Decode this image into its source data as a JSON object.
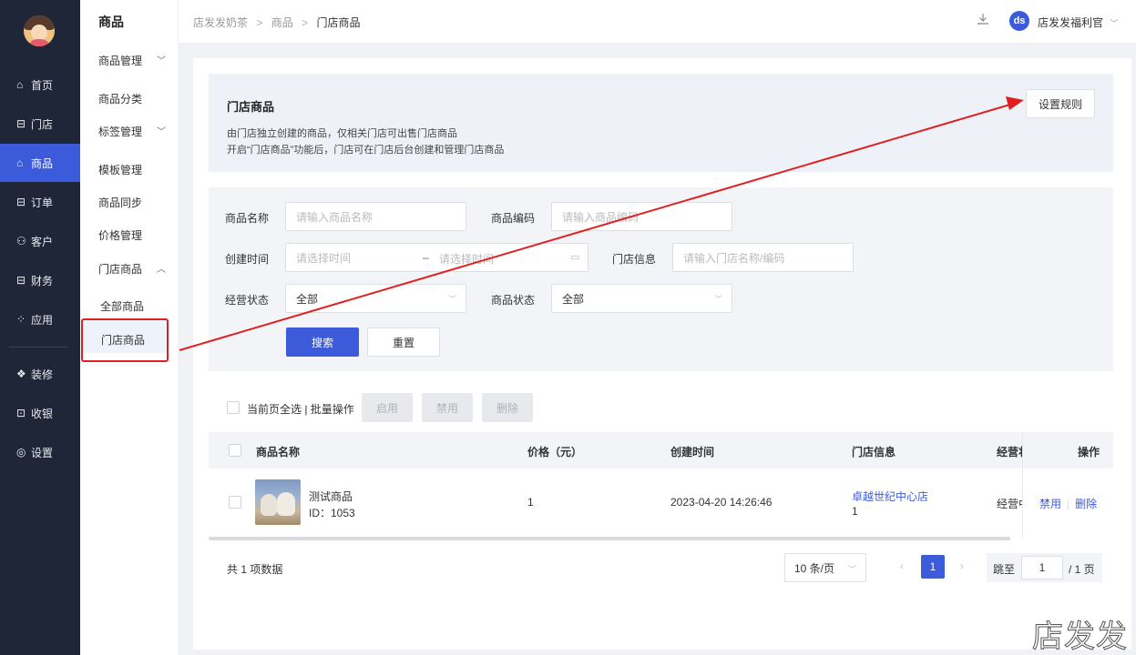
{
  "rail": {
    "items": [
      {
        "icon": "home-icon",
        "glyph": "⌂",
        "label": "首页"
      },
      {
        "icon": "store-icon",
        "glyph": "⊟",
        "label": "门店"
      },
      {
        "icon": "bag-icon",
        "glyph": "⌂",
        "label": "商品"
      },
      {
        "icon": "order-icon",
        "glyph": "⊟",
        "label": "订单"
      },
      {
        "icon": "user-icon",
        "glyph": "⚇",
        "label": "客户"
      },
      {
        "icon": "wallet-icon",
        "glyph": "⊟",
        "label": "财务"
      },
      {
        "icon": "apps-icon",
        "glyph": "⁘",
        "label": "应用"
      },
      {
        "icon": "decor-icon",
        "glyph": "❖",
        "label": "装修"
      },
      {
        "icon": "cashier-icon",
        "glyph": "⊡",
        "label": "收银"
      },
      {
        "icon": "settings-icon",
        "glyph": "◎",
        "label": "设置"
      }
    ],
    "active_index": 2
  },
  "sidebar": {
    "title": "商品",
    "items": [
      {
        "label": "商品管理",
        "chevron": "﹀"
      },
      {
        "label": "商品分类",
        "chevron": ""
      },
      {
        "label": "标签管理",
        "chevron": "﹀"
      },
      {
        "label": "模板管理",
        "chevron": ""
      },
      {
        "label": "商品同步",
        "chevron": ""
      },
      {
        "label": "价格管理",
        "chevron": ""
      },
      {
        "label": "门店商品",
        "chevron": "︿"
      }
    ],
    "sub_items": [
      "全部商品",
      "门店商品"
    ]
  },
  "topbar": {
    "breadcrumb": [
      "店发发奶茶",
      "商品",
      "门店商品"
    ],
    "sep": ">",
    "user_name": "店发发福利官",
    "user_caret": "﹀",
    "logo_text": "ds"
  },
  "intro": {
    "title": "门店商品",
    "line1": "由门店独立创建的商品，仅相关门店可出售门店商品",
    "line2": "开启“门店商品”功能后，门店可在门店后台创建和管理门店商品",
    "rules_button": "设置规则"
  },
  "filters": {
    "name_label": "商品名称",
    "name_placeholder": "请输入商品名称",
    "code_label": "商品编码",
    "code_placeholder": "请输入商品编码",
    "time_label": "创建时间",
    "time_start_placeholder": "请选择时间",
    "time_sep": "–",
    "time_end_placeholder": "请选择时间",
    "store_label": "门店信息",
    "store_placeholder": "请输入门店名称/编码",
    "biz_status_label": "经营状态",
    "biz_status_value": "全部",
    "goods_status_label": "商品状态",
    "goods_status_value": "全部",
    "search_button": "搜索",
    "reset_button": "重置"
  },
  "batch": {
    "label": "当前页全选 | 批量操作",
    "enable": "启用",
    "disable": "禁用",
    "delete": "删除"
  },
  "table": {
    "headers": {
      "name": "商品名称",
      "price": "价格（元）",
      "created": "创建时间",
      "store": "门店信息",
      "biz": "经营状",
      "ops": "操作"
    },
    "rows": [
      {
        "name": "测试商品",
        "id": "ID：1053",
        "price": "1",
        "created": "2023-04-20 14:26:46",
        "store_name": "卓越世纪中心店",
        "store_no": "1",
        "biz": "经营中",
        "op_disable": "禁用",
        "op_delete": "删除"
      }
    ]
  },
  "pagination": {
    "total": "共 1 项数据",
    "page_size": "10 条/页",
    "current": "1",
    "jump_label": "跳至",
    "jump_value": "1",
    "jump_tail": "/ 1 页",
    "prev": "‹",
    "next": "›"
  },
  "watermark": "店发发",
  "colors": {
    "accent": "#3b5bdb",
    "rail_bg": "#1f2637",
    "annotation": "#e02020"
  }
}
